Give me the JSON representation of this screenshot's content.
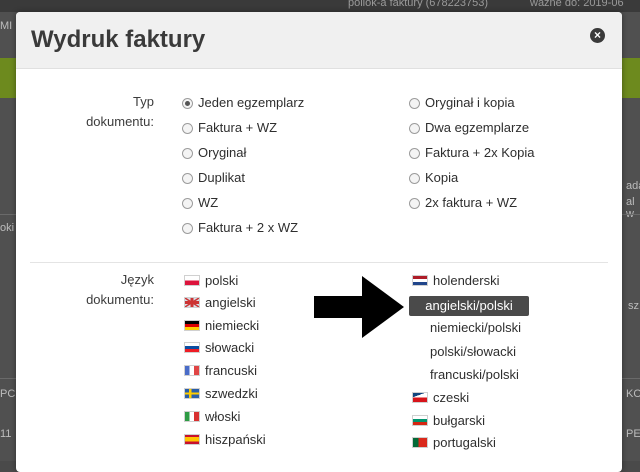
{
  "background": {
    "topbar_left": "pollok-a faktury (678223753)",
    "topbar_right": "ważne do: 2019-06",
    "side_left": [
      "MI",
      "oki",
      "PC",
      "11"
    ],
    "side_right": [
      "ada",
      "al w",
      "sz",
      "KO",
      "PE"
    ]
  },
  "modal": {
    "title": "Wydruk faktury",
    "close_label": "×"
  },
  "document_type": {
    "label_line1": "Typ",
    "label_line2": "dokumentu:",
    "selected": "Jeden egzemplarz",
    "options_left": [
      "Jeden egzemplarz",
      "Faktura + WZ",
      "Oryginał",
      "Duplikat",
      "WZ",
      "Faktura + 2 x WZ"
    ],
    "options_right": [
      "Oryginał i kopia",
      "Dwa egzemplarze",
      "Faktura + 2x Kopia",
      "Kopia",
      "2x faktura + WZ"
    ]
  },
  "language": {
    "label_line1": "Język",
    "label_line2": "dokumentu:",
    "left": [
      "polski",
      "angielski",
      "niemiecki",
      "słowacki",
      "francuski",
      "szwedzki",
      "włoski",
      "hiszpański"
    ],
    "right_top": "holenderski",
    "highlighted": "angielski/polski",
    "right_plain": [
      "niemiecki/polski",
      "polski/słowacki",
      "francuski/polski"
    ],
    "right_bottom": [
      "czeski",
      "bułgarski",
      "portugalski"
    ]
  },
  "colors": {
    "highlight_bg": "#4a4a4a",
    "overlay_bg": "#505050"
  }
}
